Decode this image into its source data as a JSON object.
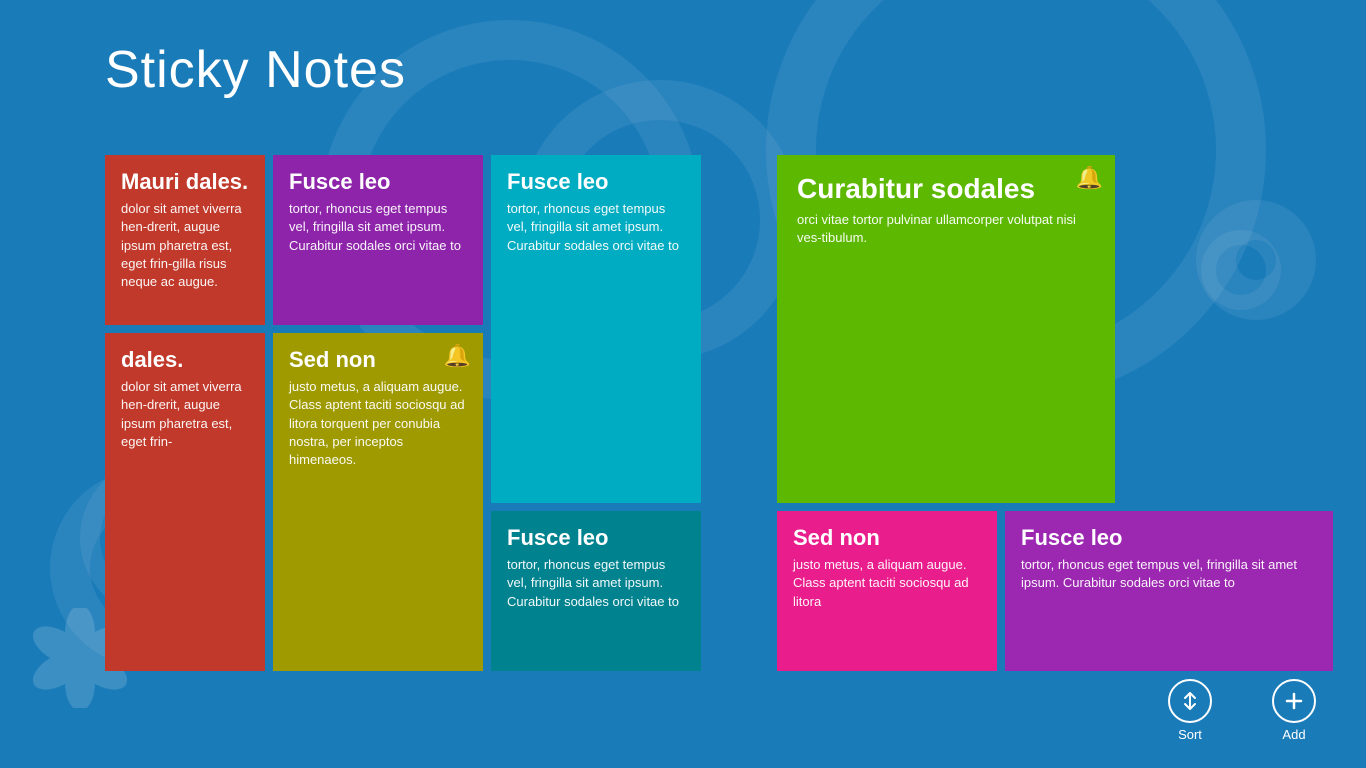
{
  "app": {
    "title": "Sticky Notes"
  },
  "notes": [
    {
      "id": "mauri-top",
      "color": "red",
      "title": "Mauri dales.",
      "body": "dolor sit amet viverra hen-drerit, augue ipsum pharetra est, eget frin-gilla risus neque ac augue.",
      "bell": false,
      "gridClass": "note-mauri-top note-red"
    },
    {
      "id": "mauri-bot",
      "color": "red",
      "title": "dales.",
      "body": "dolor sit amet viverra hen-drerit, augue ipsum pharetra est, eget frin-",
      "bell": false,
      "gridClass": "note-mauri-bot note-red"
    },
    {
      "id": "fusce-purple",
      "color": "purple",
      "title": "Fusce leo",
      "body": "tortor, rhoncus eget tempus vel, fringilla sit amet ipsum. Curabitur sodales orci vitae to",
      "bell": false,
      "gridClass": "note-fusce-purple note-purple"
    },
    {
      "id": "sed-non",
      "color": "yellow",
      "title": "Sed non",
      "body": "justo metus, a aliquam augue. Class aptent taciti sociosqu ad litora torquent per conubia nostra, per inceptos himenaeos.",
      "bell": true,
      "gridClass": "note-sed-non note-yellow"
    },
    {
      "id": "fusce-teal-1",
      "color": "teal",
      "title": "Fusce leo",
      "body": "tortor, rhoncus eget tempus vel, fringilla sit amet ipsum. Curabitur sodales orci vitae to",
      "bell": false,
      "gridClass": "note-fusce-teal-1"
    },
    {
      "id": "fusce-teal-2",
      "color": "teal",
      "title": "Fusce leo",
      "body": "tortor, rhoncus eget tempus vel, fringilla sit amet ipsum. Curabitur sodales orci vitae to",
      "bell": false,
      "gridClass": "note-fusce-teal-2 note-teal"
    },
    {
      "id": "curabitur",
      "color": "green",
      "title": "Curabitur sodales",
      "body": "orci vitae tortor pulvinar ullamcorper volutpat nisi ves-tibulum.",
      "bell": true,
      "gridClass": "note-curabitur note-green"
    },
    {
      "id": "sed-non-pink",
      "color": "pink",
      "title": "Sed non",
      "body": "justo metus, a aliquam augue. Class aptent taciti sociosqu ad litora",
      "bell": false,
      "gridClass": "note-sed-non-pink note-pink"
    },
    {
      "id": "fusce-violet",
      "color": "violet",
      "title": "Fusce leo",
      "body": "tortor, rhoncus eget tempus vel, fringilla sit amet ipsum. Curabitur sodales orci vitae to",
      "bell": false,
      "gridClass": "note-fusce-violet note-violet"
    }
  ],
  "bottomBar": {
    "sort": {
      "label": "Sort",
      "icon": "↕"
    },
    "add": {
      "label": "Add",
      "icon": "+"
    }
  }
}
